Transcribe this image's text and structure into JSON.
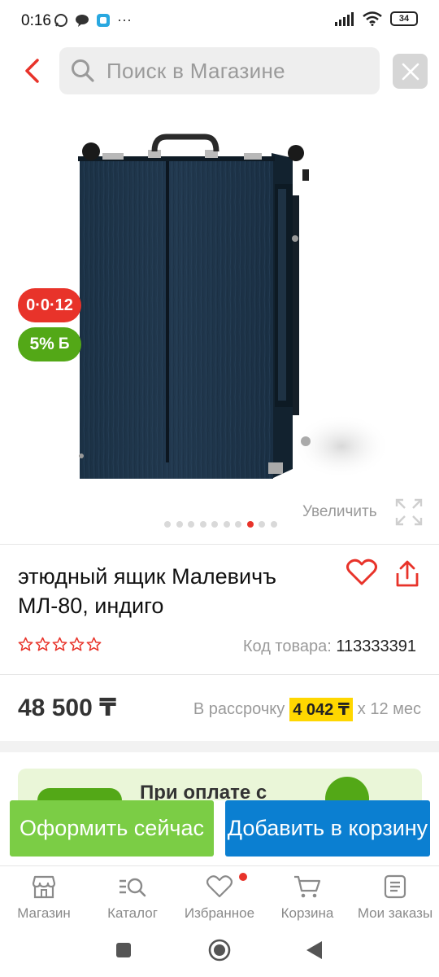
{
  "status_bar": {
    "time": "0:16",
    "battery": "34"
  },
  "header": {
    "search_placeholder": "Поиск в Магазине"
  },
  "gallery": {
    "badge_installment": "0·0·12",
    "badge_bonus": "5%",
    "badge_bonus_suffix": "Б",
    "zoom_label": "Увеличить",
    "total_images": 10,
    "active_image_index": 7
  },
  "product": {
    "title": "этюдный ящик Малевичъ МЛ-80, индиго",
    "rating_stars": 0,
    "sku_label": "Код товара:",
    "sku_value": "113333391",
    "price": "48 500 ₸",
    "installment_label": "В рассрочку",
    "installment_amount": "4 042 ₸",
    "installment_term": "x 12 мес"
  },
  "promo": {
    "text": "При оплате с"
  },
  "actions": {
    "buy_now": "Оформить сейчас",
    "add_to_cart": "Добавить в корзину"
  },
  "bottom_nav": {
    "items": [
      {
        "label": "Магазин",
        "icon": "shop-icon"
      },
      {
        "label": "Каталог",
        "icon": "catalog-search-icon"
      },
      {
        "label": "Избранное",
        "icon": "heart-icon"
      },
      {
        "label": "Корзина",
        "icon": "cart-icon"
      },
      {
        "label": "Мои заказы",
        "icon": "orders-icon"
      }
    ]
  },
  "colors": {
    "accent_red": "#e8332a",
    "buy_green": "#7bcd45",
    "cart_blue": "#0b7fd1",
    "bonus_green": "#53a817",
    "installment_yellow": "#ffd700"
  }
}
